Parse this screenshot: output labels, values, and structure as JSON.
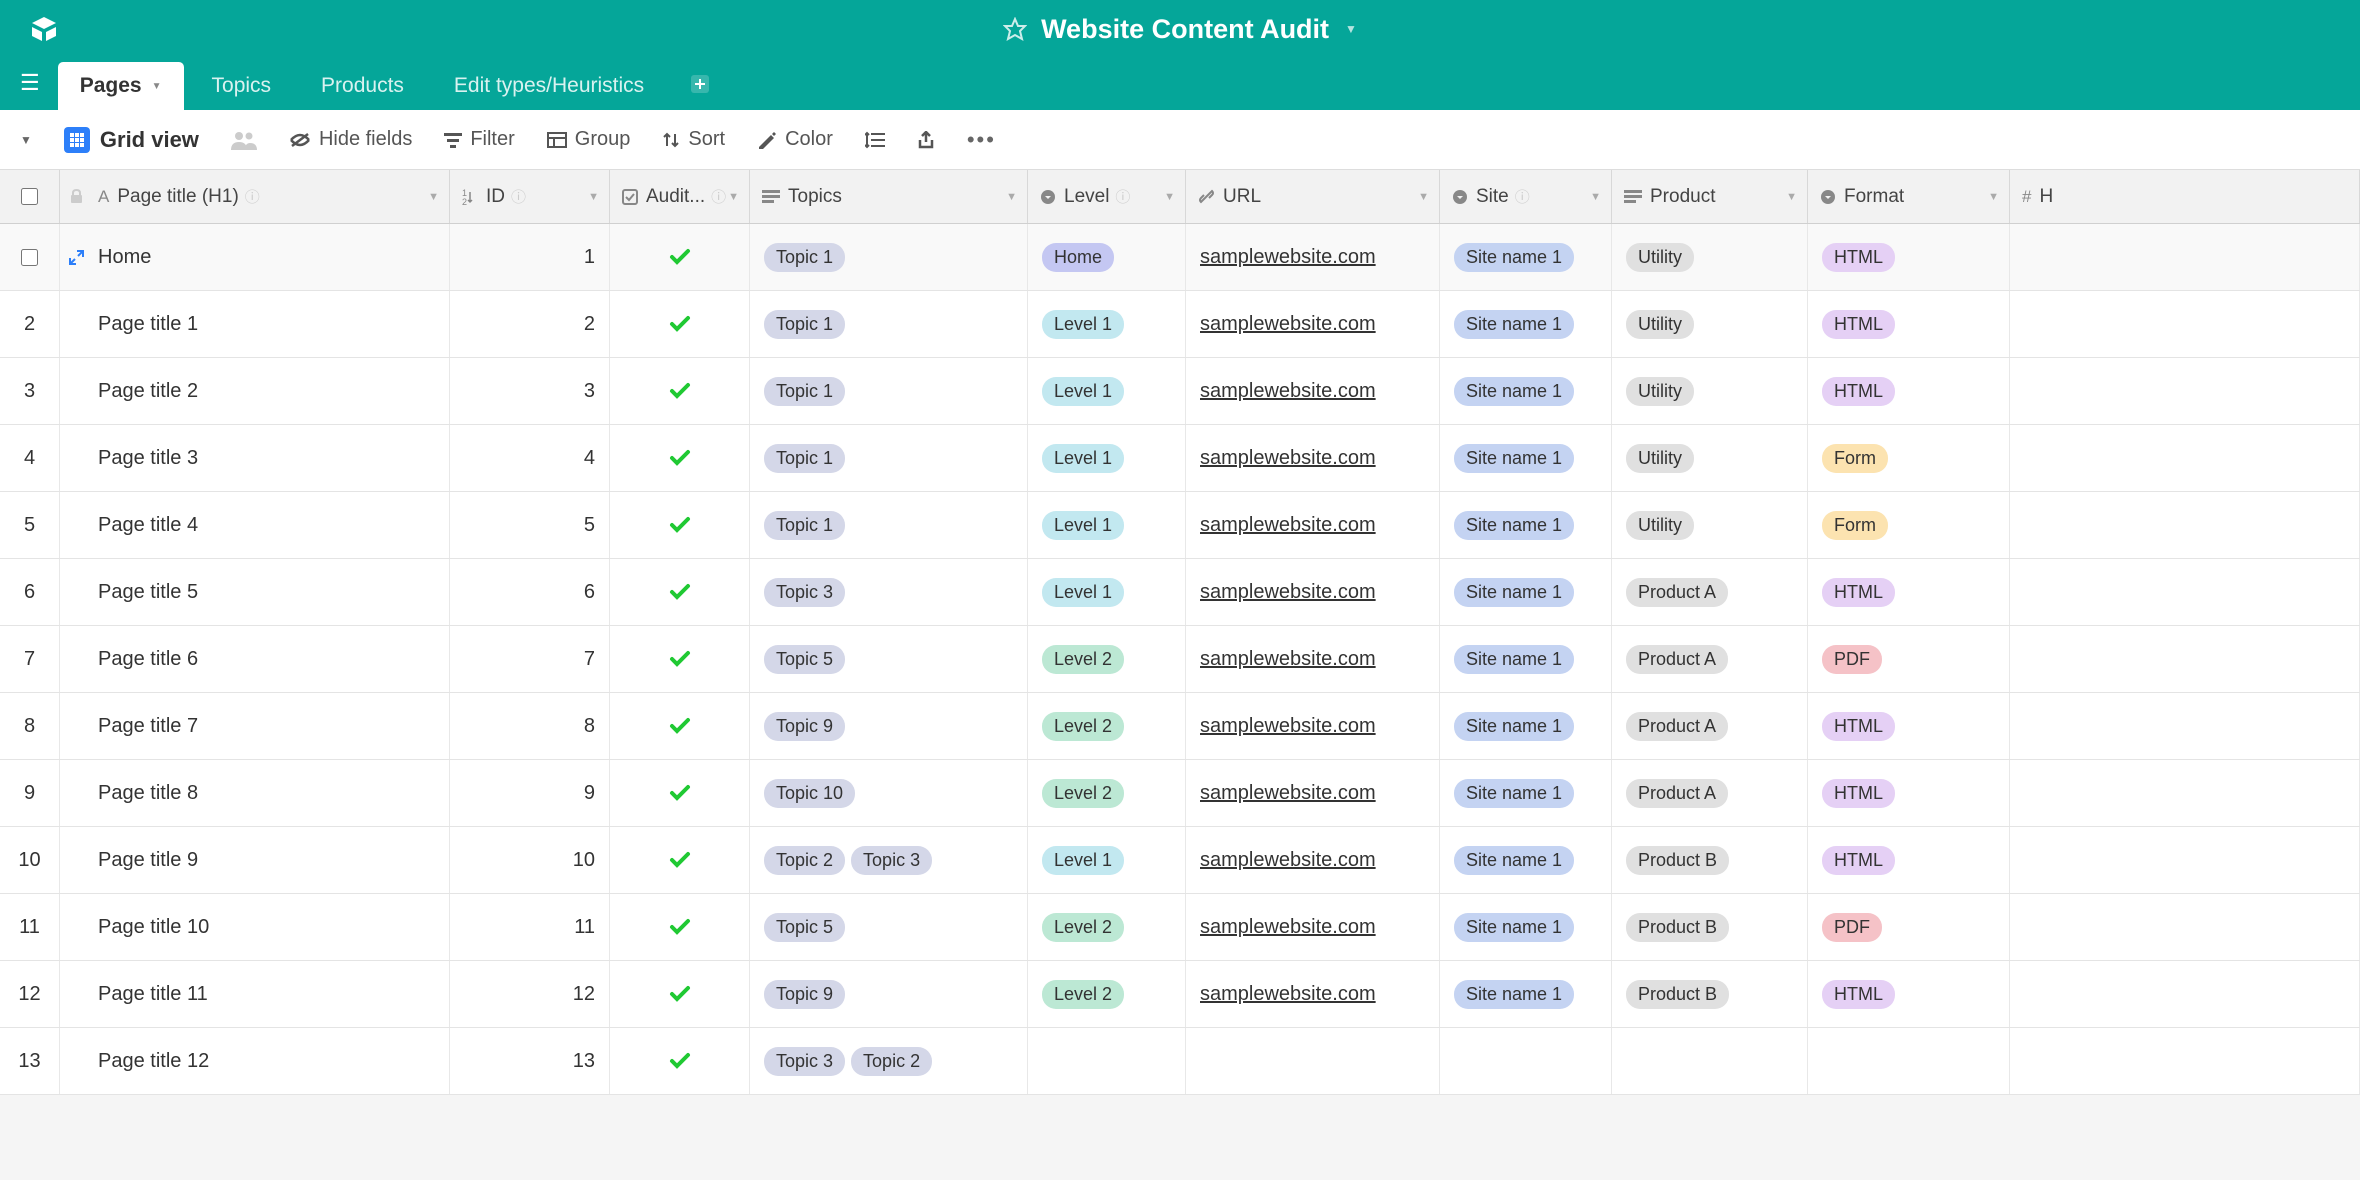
{
  "header": {
    "title": "Website Content Audit"
  },
  "tabs": [
    "Pages",
    "Topics",
    "Products",
    "Edit types/Heuristics"
  ],
  "active_tab": 0,
  "toolbar": {
    "view_label": "Grid view",
    "hide_fields": "Hide fields",
    "filter": "Filter",
    "group": "Group",
    "sort": "Sort",
    "color": "Color"
  },
  "columns": {
    "title": "Page title (H1)",
    "id": "ID",
    "audit": "Audit...",
    "topics": "Topics",
    "level": "Level",
    "url": "URL",
    "site": "Site",
    "product": "Product",
    "format": "Format",
    "h": "H"
  },
  "rows": [
    {
      "n": "",
      "title": "Home",
      "id": "1",
      "audit": true,
      "topics": [
        "Topic 1"
      ],
      "level": "Home",
      "level_class": "pill-home",
      "url": "samplewebsite.com",
      "site": "Site name 1",
      "product": "Utility",
      "format": "HTML",
      "format_class": "pill-html",
      "expand": true,
      "checkbox": true
    },
    {
      "n": "2",
      "title": "Page title 1",
      "id": "2",
      "audit": true,
      "topics": [
        "Topic 1"
      ],
      "level": "Level 1",
      "level_class": "pill-level1",
      "url": "samplewebsite.com",
      "site": "Site name 1",
      "product": "Utility",
      "format": "HTML",
      "format_class": "pill-html"
    },
    {
      "n": "3",
      "title": "Page title 2",
      "id": "3",
      "audit": true,
      "topics": [
        "Topic 1"
      ],
      "level": "Level 1",
      "level_class": "pill-level1",
      "url": "samplewebsite.com",
      "site": "Site name 1",
      "product": "Utility",
      "format": "HTML",
      "format_class": "pill-html"
    },
    {
      "n": "4",
      "title": "Page title 3",
      "id": "4",
      "audit": true,
      "topics": [
        "Topic 1"
      ],
      "level": "Level 1",
      "level_class": "pill-level1",
      "url": "samplewebsite.com",
      "site": "Site name 1",
      "product": "Utility",
      "format": "Form",
      "format_class": "pill-form"
    },
    {
      "n": "5",
      "title": "Page title 4",
      "id": "5",
      "audit": true,
      "topics": [
        "Topic 1"
      ],
      "level": "Level 1",
      "level_class": "pill-level1",
      "url": "samplewebsite.com",
      "site": "Site name 1",
      "product": "Utility",
      "format": "Form",
      "format_class": "pill-form"
    },
    {
      "n": "6",
      "title": "Page title 5",
      "id": "6",
      "audit": true,
      "topics": [
        "Topic 3"
      ],
      "level": "Level 1",
      "level_class": "pill-level1",
      "url": "samplewebsite.com",
      "site": "Site name 1",
      "product": "Product A",
      "format": "HTML",
      "format_class": "pill-html"
    },
    {
      "n": "7",
      "title": "Page title 6",
      "id": "7",
      "audit": true,
      "topics": [
        "Topic 5"
      ],
      "level": "Level 2",
      "level_class": "pill-level2",
      "url": "samplewebsite.com",
      "site": "Site name 1",
      "product": "Product A",
      "format": "PDF",
      "format_class": "pill-pdf"
    },
    {
      "n": "8",
      "title": "Page title 7",
      "id": "8",
      "audit": true,
      "topics": [
        "Topic 9"
      ],
      "level": "Level 2",
      "level_class": "pill-level2",
      "url": "samplewebsite.com",
      "site": "Site name 1",
      "product": "Product A",
      "format": "HTML",
      "format_class": "pill-html"
    },
    {
      "n": "9",
      "title": "Page title 8",
      "id": "9",
      "audit": true,
      "topics": [
        "Topic 10"
      ],
      "level": "Level 2",
      "level_class": "pill-level2",
      "url": "samplewebsite.com",
      "site": "Site name 1",
      "product": "Product A",
      "format": "HTML",
      "format_class": "pill-html"
    },
    {
      "n": "10",
      "title": "Page title 9",
      "id": "10",
      "audit": true,
      "topics": [
        "Topic 2",
        "Topic 3"
      ],
      "level": "Level 1",
      "level_class": "pill-level1",
      "url": "samplewebsite.com",
      "site": "Site name 1",
      "product": "Product B",
      "format": "HTML",
      "format_class": "pill-html"
    },
    {
      "n": "11",
      "title": "Page title 10",
      "id": "11",
      "audit": true,
      "topics": [
        "Topic 5"
      ],
      "level": "Level 2",
      "level_class": "pill-level2",
      "url": "samplewebsite.com",
      "site": "Site name 1",
      "product": "Product B",
      "format": "PDF",
      "format_class": "pill-pdf"
    },
    {
      "n": "12",
      "title": "Page title 11",
      "id": "12",
      "audit": true,
      "topics": [
        "Topic 9"
      ],
      "level": "Level 2",
      "level_class": "pill-level2",
      "url": "samplewebsite.com",
      "site": "Site name 1",
      "product": "Product B",
      "format": "HTML",
      "format_class": "pill-html"
    },
    {
      "n": "13",
      "title": "Page title 12",
      "id": "13",
      "audit": true,
      "topics": [
        "Topic 3",
        "Topic 2"
      ],
      "level": "",
      "level_class": "",
      "url": "",
      "site": "",
      "product": "",
      "format": "",
      "format_class": ""
    }
  ]
}
